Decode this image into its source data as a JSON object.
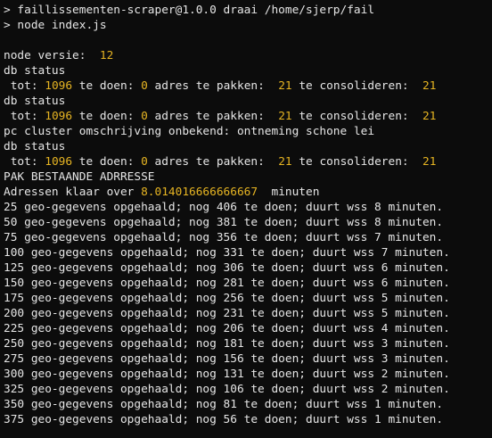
{
  "colors": {
    "background": "#0c0c0c",
    "text": "#e6e6e6",
    "number": "#e6b422"
  },
  "lines": [
    [
      {
        "t": "> faillissementen-scraper@1.0.0 draai /home/sjerp/fail"
      }
    ],
    [
      {
        "t": "> node index.js"
      }
    ],
    [
      {
        "t": ""
      }
    ],
    [
      {
        "t": "node versie:  "
      },
      {
        "t": "12",
        "c": "num"
      }
    ],
    [
      {
        "t": "db status"
      }
    ],
    [
      {
        "t": " tot: "
      },
      {
        "t": "1096",
        "c": "num"
      },
      {
        "t": " te doen: "
      },
      {
        "t": "0",
        "c": "num"
      },
      {
        "t": " adres te pakken:  "
      },
      {
        "t": "21",
        "c": "num"
      },
      {
        "t": " te consolideren:  "
      },
      {
        "t": "21",
        "c": "num"
      }
    ],
    [
      {
        "t": "db status"
      }
    ],
    [
      {
        "t": " tot: "
      },
      {
        "t": "1096",
        "c": "num"
      },
      {
        "t": " te doen: "
      },
      {
        "t": "0",
        "c": "num"
      },
      {
        "t": " adres te pakken:  "
      },
      {
        "t": "21",
        "c": "num"
      },
      {
        "t": " te consolideren:  "
      },
      {
        "t": "21",
        "c": "num"
      }
    ],
    [
      {
        "t": "pc cluster omschrijving onbekend: ontneming schone lei"
      }
    ],
    [
      {
        "t": "db status"
      }
    ],
    [
      {
        "t": " tot: "
      },
      {
        "t": "1096",
        "c": "num"
      },
      {
        "t": " te doen: "
      },
      {
        "t": "0",
        "c": "num"
      },
      {
        "t": " adres te pakken:  "
      },
      {
        "t": "21",
        "c": "num"
      },
      {
        "t": " te consolideren:  "
      },
      {
        "t": "21",
        "c": "num"
      }
    ],
    [
      {
        "t": "PAK BESTAANDE ADRRESSE"
      }
    ],
    [
      {
        "t": "Adressen klaar over "
      },
      {
        "t": "8.014016666666667",
        "c": "num"
      },
      {
        "t": "  minuten"
      }
    ],
    [
      {
        "t": "25 geo-gegevens opgehaald; nog 406 te doen; duurt wss 8 minuten."
      }
    ],
    [
      {
        "t": "50 geo-gegevens opgehaald; nog 381 te doen; duurt wss 8 minuten."
      }
    ],
    [
      {
        "t": "75 geo-gegevens opgehaald; nog 356 te doen; duurt wss 7 minuten."
      }
    ],
    [
      {
        "t": "100 geo-gegevens opgehaald; nog 331 te doen; duurt wss 7 minuten."
      }
    ],
    [
      {
        "t": "125 geo-gegevens opgehaald; nog 306 te doen; duurt wss 6 minuten."
      }
    ],
    [
      {
        "t": "150 geo-gegevens opgehaald; nog 281 te doen; duurt wss 6 minuten."
      }
    ],
    [
      {
        "t": "175 geo-gegevens opgehaald; nog 256 te doen; duurt wss 5 minuten."
      }
    ],
    [
      {
        "t": "200 geo-gegevens opgehaald; nog 231 te doen; duurt wss 5 minuten."
      }
    ],
    [
      {
        "t": "225 geo-gegevens opgehaald; nog 206 te doen; duurt wss 4 minuten."
      }
    ],
    [
      {
        "t": "250 geo-gegevens opgehaald; nog 181 te doen; duurt wss 3 minuten."
      }
    ],
    [
      {
        "t": "275 geo-gegevens opgehaald; nog 156 te doen; duurt wss 3 minuten."
      }
    ],
    [
      {
        "t": "300 geo-gegevens opgehaald; nog 131 te doen; duurt wss 2 minuten."
      }
    ],
    [
      {
        "t": "325 geo-gegevens opgehaald; nog 106 te doen; duurt wss 2 minuten."
      }
    ],
    [
      {
        "t": "350 geo-gegevens opgehaald; nog 81 te doen; duurt wss 1 minuten."
      }
    ],
    [
      {
        "t": "375 geo-gegevens opgehaald; nog 56 te doen; duurt wss 1 minuten."
      }
    ]
  ]
}
